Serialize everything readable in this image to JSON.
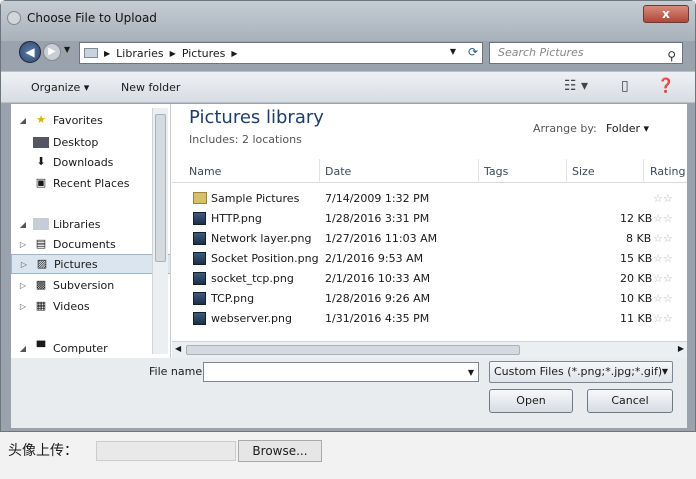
{
  "window": {
    "title": "Choose File to Upload",
    "close_label": "x"
  },
  "address": {
    "crumbs": [
      "Libraries",
      "Pictures"
    ],
    "search_placeholder": "Search Pictures"
  },
  "toolbar": {
    "organize": "Organize",
    "new_folder": "New folder"
  },
  "sidebar": {
    "favorites": "Favorites",
    "favorite_items": [
      "Desktop",
      "Downloads",
      "Recent Places"
    ],
    "libraries": "Libraries",
    "library_items": [
      "Documents",
      "Pictures",
      "Subversion",
      "Videos"
    ],
    "computer": "Computer",
    "selected": "Pictures"
  },
  "library": {
    "title": "Pictures library",
    "includes": "Includes:  2 locations",
    "arrange_label": "Arrange by:",
    "arrange_value": "Folder"
  },
  "columns": [
    "Name",
    "Date",
    "Tags",
    "Size",
    "Rating"
  ],
  "files": [
    {
      "name": "Sample Pictures",
      "date": "7/14/2009 1:32 PM",
      "size": "",
      "type": "folder"
    },
    {
      "name": "HTTP.png",
      "date": "1/28/2016 3:31 PM",
      "size": "12 KB",
      "type": "file"
    },
    {
      "name": "Network layer.png",
      "date": "1/27/2016 11:03 AM",
      "size": "8 KB",
      "type": "file"
    },
    {
      "name": "Socket Position.png",
      "date": "2/1/2016 9:53 AM",
      "size": "15 KB",
      "type": "file"
    },
    {
      "name": "socket_tcp.png",
      "date": "2/1/2016 10:33 AM",
      "size": "20 KB",
      "type": "file"
    },
    {
      "name": "TCP.png",
      "date": "1/28/2016 9:26 AM",
      "size": "10 KB",
      "type": "file"
    },
    {
      "name": "webserver.png",
      "date": "1/31/2016 4:35 PM",
      "size": "11 KB",
      "type": "file"
    }
  ],
  "bottom": {
    "file_name_label": "File name:",
    "file_name_value": "",
    "filter": "Custom Files (*.png;*.jpg;*.gif)",
    "open": "Open",
    "cancel": "Cancel"
  },
  "page": {
    "upload_label": "头像上传：",
    "browse": "Browse..."
  }
}
